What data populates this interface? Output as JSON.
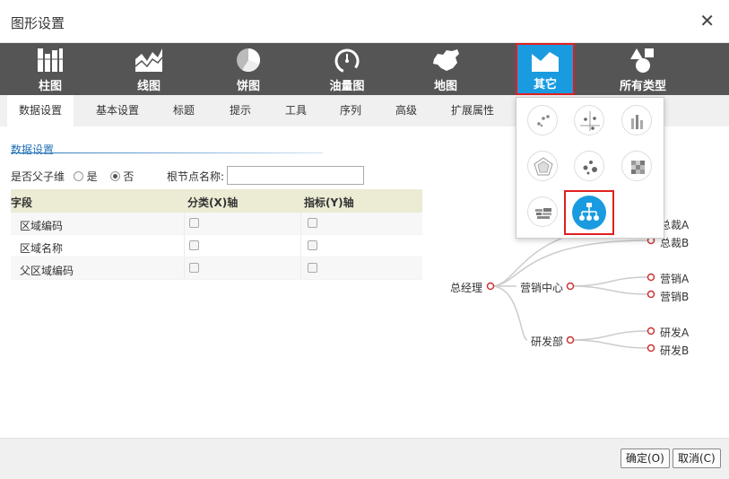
{
  "dialog": {
    "title": "图形设置",
    "close_label": "✕"
  },
  "chart_types": [
    {
      "label": "柱图"
    },
    {
      "label": "线图"
    },
    {
      "label": "饼图"
    },
    {
      "label": "油量图"
    },
    {
      "label": "地图"
    },
    {
      "label": "其它"
    },
    {
      "label": "所有类型"
    }
  ],
  "tabs": [
    "数据设置",
    "基本设置",
    "标题",
    "提示",
    "工具",
    "序列",
    "高级",
    "扩展属性"
  ],
  "data_settings": {
    "section_title": "数据设置",
    "parent_child_label": "是否父子维",
    "yes_label": "是",
    "no_label": "否",
    "root_name_label": "根节点名称:",
    "root_name_value": ""
  },
  "field_table": {
    "headers": [
      "字段",
      "分类(X)轴",
      "指标(Y)轴"
    ],
    "rows": [
      {
        "name": "区域编码"
      },
      {
        "name": "区域名称"
      },
      {
        "name": "父区域编码"
      }
    ]
  },
  "tree_preview": {
    "root": "总经理",
    "level1": [
      "营销中心",
      "研发部"
    ],
    "leaves": [
      "总裁A",
      "总裁B",
      "营销A",
      "营销B",
      "研发A",
      "研发B"
    ]
  },
  "colors": {
    "accent": "#1a9be0",
    "highlight": "#e02020",
    "toolbar_bg": "#555555",
    "tree_node": "#cc3333"
  },
  "footer": {
    "ok_label": "确定(O)",
    "cancel_label": "取消(C)"
  }
}
